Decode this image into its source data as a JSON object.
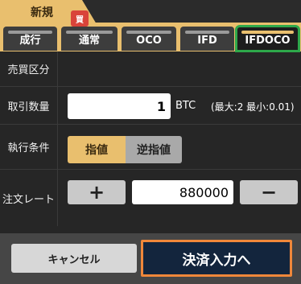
{
  "header": {
    "new_tab_label": "新規"
  },
  "order_tabs": [
    {
      "label": "成行",
      "active": false
    },
    {
      "label": "通常",
      "active": false
    },
    {
      "label": "OCO",
      "active": false
    },
    {
      "label": "IFD",
      "active": false
    },
    {
      "label": "IFDOCO",
      "active": true
    }
  ],
  "side": {
    "label": "売買区分",
    "badge": "買"
  },
  "quantity": {
    "label": "取引数量",
    "value": "1",
    "unit": "BTC",
    "limit": "(最大:2 最小:0.01)"
  },
  "execution": {
    "label": "執行条件",
    "options": [
      "指値",
      "逆指値"
    ],
    "selected": "指値"
  },
  "rate": {
    "label": "注文レート",
    "value": "880000",
    "plus": "+",
    "minus": "−"
  },
  "footer": {
    "cancel_label": "キャンセル",
    "proceed_label": "決済入力へ"
  },
  "colors": {
    "accent": "#e9bf6e",
    "buy": "#d9443a",
    "highlight_green": "#2ea84a",
    "highlight_orange": "#f0873a",
    "proceed_bg": "#13253d"
  }
}
